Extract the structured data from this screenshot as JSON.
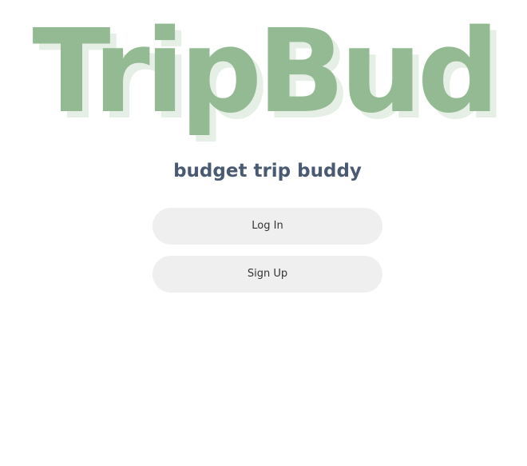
{
  "app": {
    "logo_text": "TripBud",
    "tagline": "budget trip buddy"
  },
  "actions": {
    "login_label": "Log In",
    "signup_label": "Sign Up"
  },
  "colors": {
    "logo": "#93ba92",
    "logo_shadow": "#e6efe5",
    "tagline": "#4a5a72",
    "button_bg": "#efefef"
  }
}
